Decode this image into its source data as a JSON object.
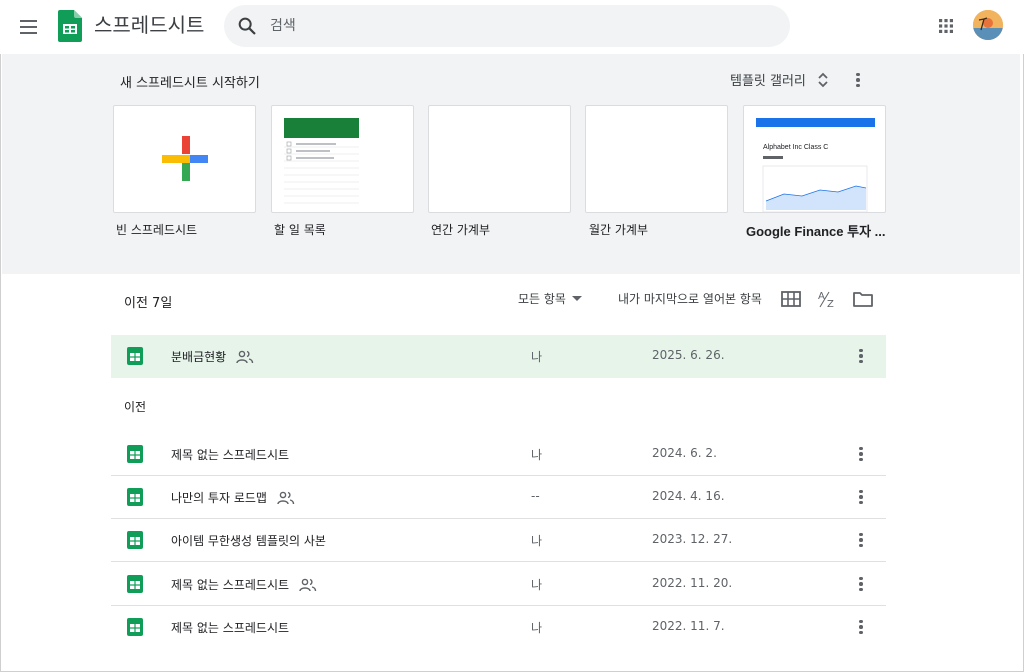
{
  "header": {
    "app_title": "스프레드시트",
    "search_placeholder": "검색"
  },
  "templates": {
    "title": "새 스프레드시트 시작하기",
    "gallery_label": "템플릿 갤러리",
    "items": [
      {
        "label": "빈 스프레드시트"
      },
      {
        "label": "할 일 목록"
      },
      {
        "label": "연간 가계부"
      },
      {
        "label": "월간 가계부"
      },
      {
        "label": "Google Finance 투자 ...",
        "preview_text": "Alphabet Inc Class C"
      }
    ]
  },
  "list": {
    "section_title": "이전 7일",
    "owner_filter": "모든 항목",
    "sort_label": "내가 마지막으로 열어본 항목",
    "group_label": "이전",
    "recent": [
      {
        "name": "분배금현황",
        "owner": "나",
        "date": "2025. 6. 26.",
        "shared": true
      }
    ],
    "older": [
      {
        "name": "제목 없는 스프레드시트",
        "owner": "나",
        "date": "2024. 6. 2.",
        "shared": false
      },
      {
        "name": "나만의 투자 로드맵",
        "owner": "--",
        "date": "2024. 4. 16.",
        "shared": true
      },
      {
        "name": "아이템 무한생성 템플릿의 사본",
        "owner": "나",
        "date": "2023. 12. 27.",
        "shared": false
      },
      {
        "name": "제목 없는 스프레드시트",
        "owner": "나",
        "date": "2022. 11. 20.",
        "shared": true
      },
      {
        "name": "제목 없는 스프레드시트",
        "owner": "나",
        "date": "2022. 11. 7.",
        "shared": false
      }
    ]
  },
  "colors": {
    "sheets_green": "#0f9d58",
    "selected_row": "#e6f4ea",
    "band_bg": "#f1f3f4"
  }
}
